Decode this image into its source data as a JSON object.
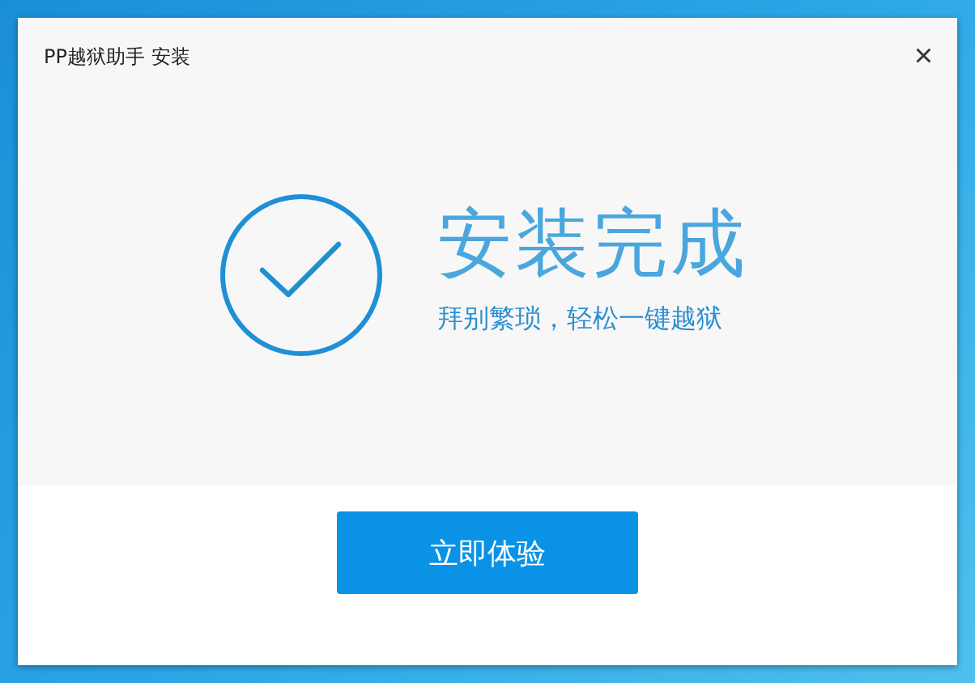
{
  "window": {
    "title": "PP越狱助手 安装",
    "close": "×"
  },
  "result": {
    "heading": "安装完成",
    "subtitle": "拜别繁琐，轻松一键越狱"
  },
  "buttons": [
    "立即体验"
  ]
}
